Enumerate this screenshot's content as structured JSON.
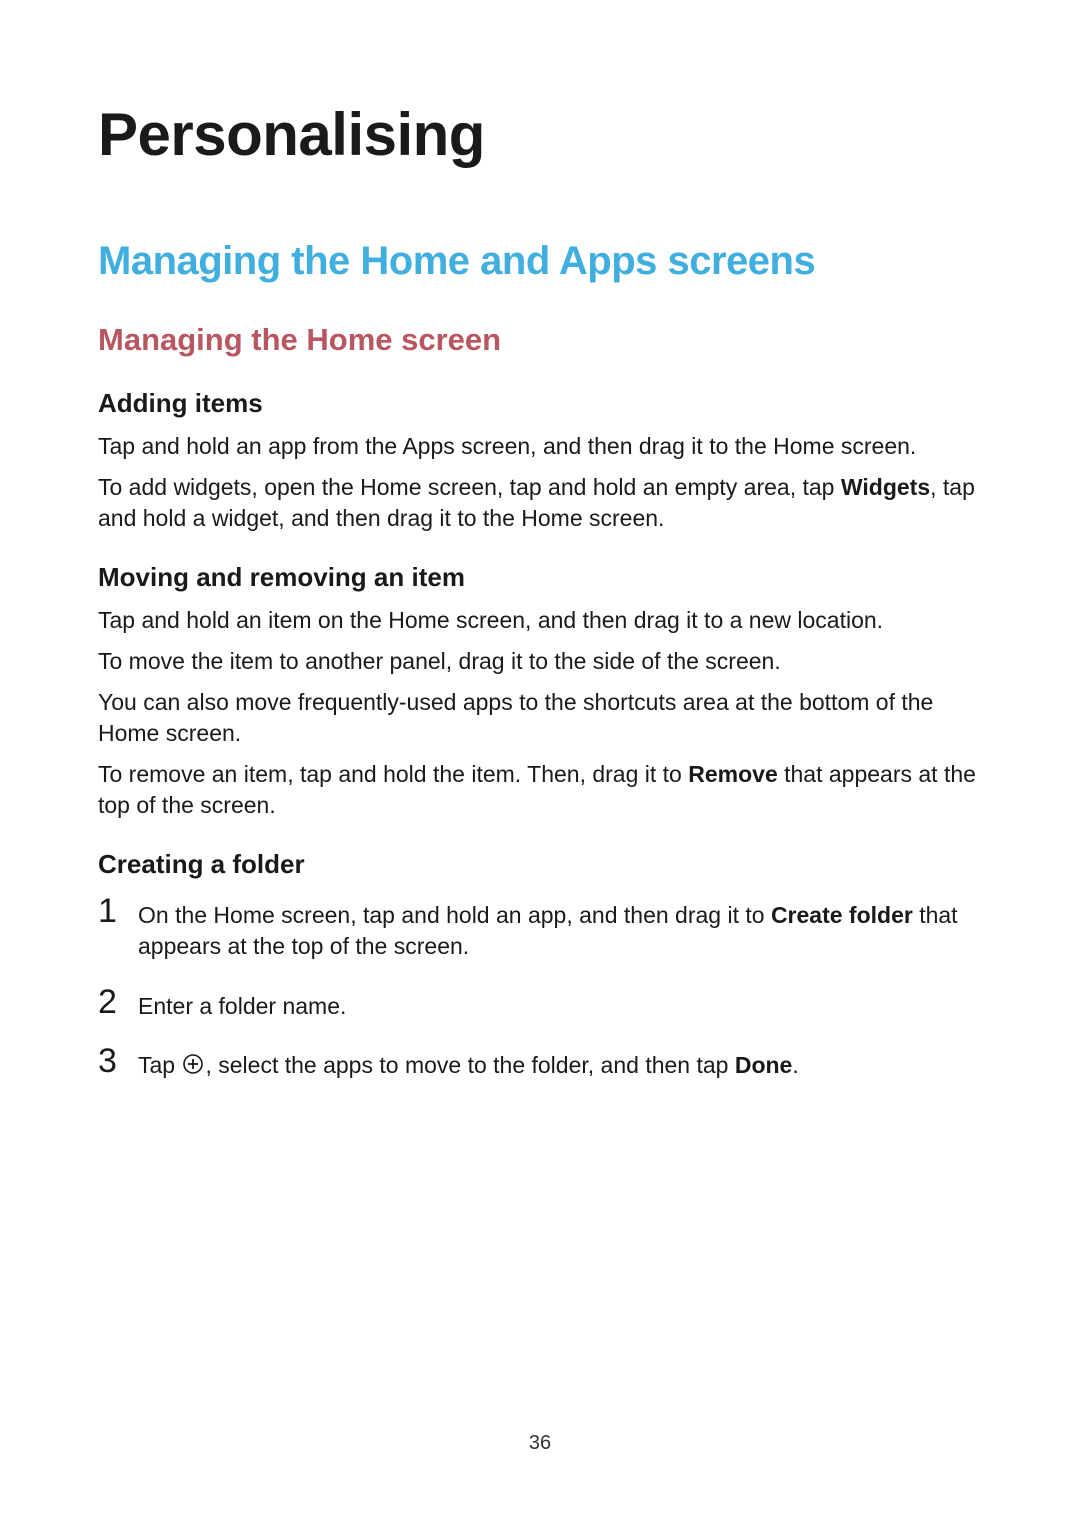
{
  "page_number": "36",
  "h1": "Personalising",
  "h2": "Managing the Home and Apps screens",
  "h3": "Managing the Home screen",
  "sections": {
    "adding_items": {
      "title": "Adding items",
      "p1": "Tap and hold an app from the Apps screen, and then drag it to the Home screen.",
      "p2a": "To add widgets, open the Home screen, tap and hold an empty area, tap ",
      "p2b": "Widgets",
      "p2c": ", tap and hold a widget, and then drag it to the Home screen."
    },
    "moving_removing": {
      "title": "Moving and removing an item",
      "p1": "Tap and hold an item on the Home screen, and then drag it to a new location.",
      "p2": "To move the item to another panel, drag it to the side of the screen.",
      "p3": "You can also move frequently-used apps to the shortcuts area at the bottom of the Home screen.",
      "p4a": "To remove an item, tap and hold the item. Then, drag it to ",
      "p4b": "Remove",
      "p4c": " that appears at the top of the screen."
    },
    "creating_folder": {
      "title": "Creating a folder",
      "steps": {
        "n1": "1",
        "s1a": "On the Home screen, tap and hold an app, and then drag it to ",
        "s1b": "Create folder",
        "s1c": " that appears at the top of the screen.",
        "n2": "2",
        "s2": "Enter a folder name.",
        "n3": "3",
        "s3a": "Tap ",
        "s3b": ", select the apps to move to the folder, and then tap ",
        "s3c": "Done",
        "s3d": "."
      }
    }
  }
}
